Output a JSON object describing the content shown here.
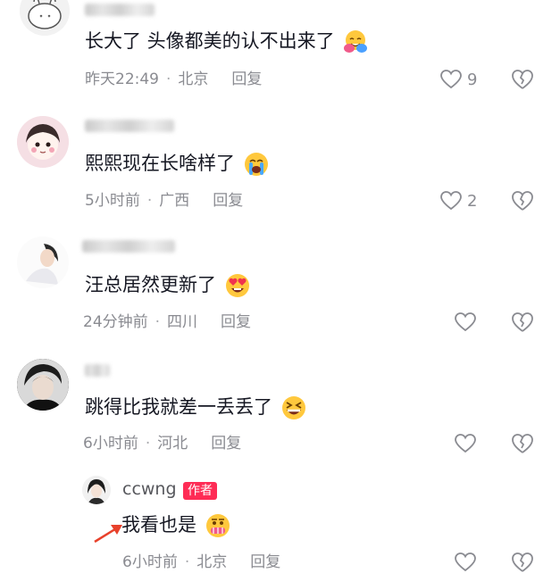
{
  "comments": [
    {
      "text": "长大了 头像都美的认不出来了",
      "emoji": "hugging-face-emoji",
      "time": "昨天22:49",
      "location": "北京",
      "reply": "回复",
      "likes": "9"
    },
    {
      "text": "熙熙现在长啥样了",
      "emoji": "loudly-crying-face-emoji",
      "time": "5小时前",
      "location": "广西",
      "reply": "回复",
      "likes": "2"
    },
    {
      "text": "汪总居然更新了",
      "emoji": "heart-eyes-face-emoji",
      "time": "24分钟前",
      "location": "四川",
      "reply": "回复",
      "likes": ""
    },
    {
      "text": "跳得比我就差一丢丢了",
      "emoji": "grinning-squinting-face-emoji",
      "time": "6小时前",
      "location": "河北",
      "reply": "回复",
      "likes": ""
    }
  ],
  "author_reply": {
    "username": "ccwng",
    "badge": "作者",
    "text": "我看也是",
    "emoji": "money-mouth-face-emoji",
    "time": "6小时前",
    "location": "北京",
    "reply": "回复"
  },
  "colors": {
    "text": "#161823",
    "meta": "#8a8b91",
    "author_badge": "#fe2c55",
    "arrow": "#e8412b"
  }
}
